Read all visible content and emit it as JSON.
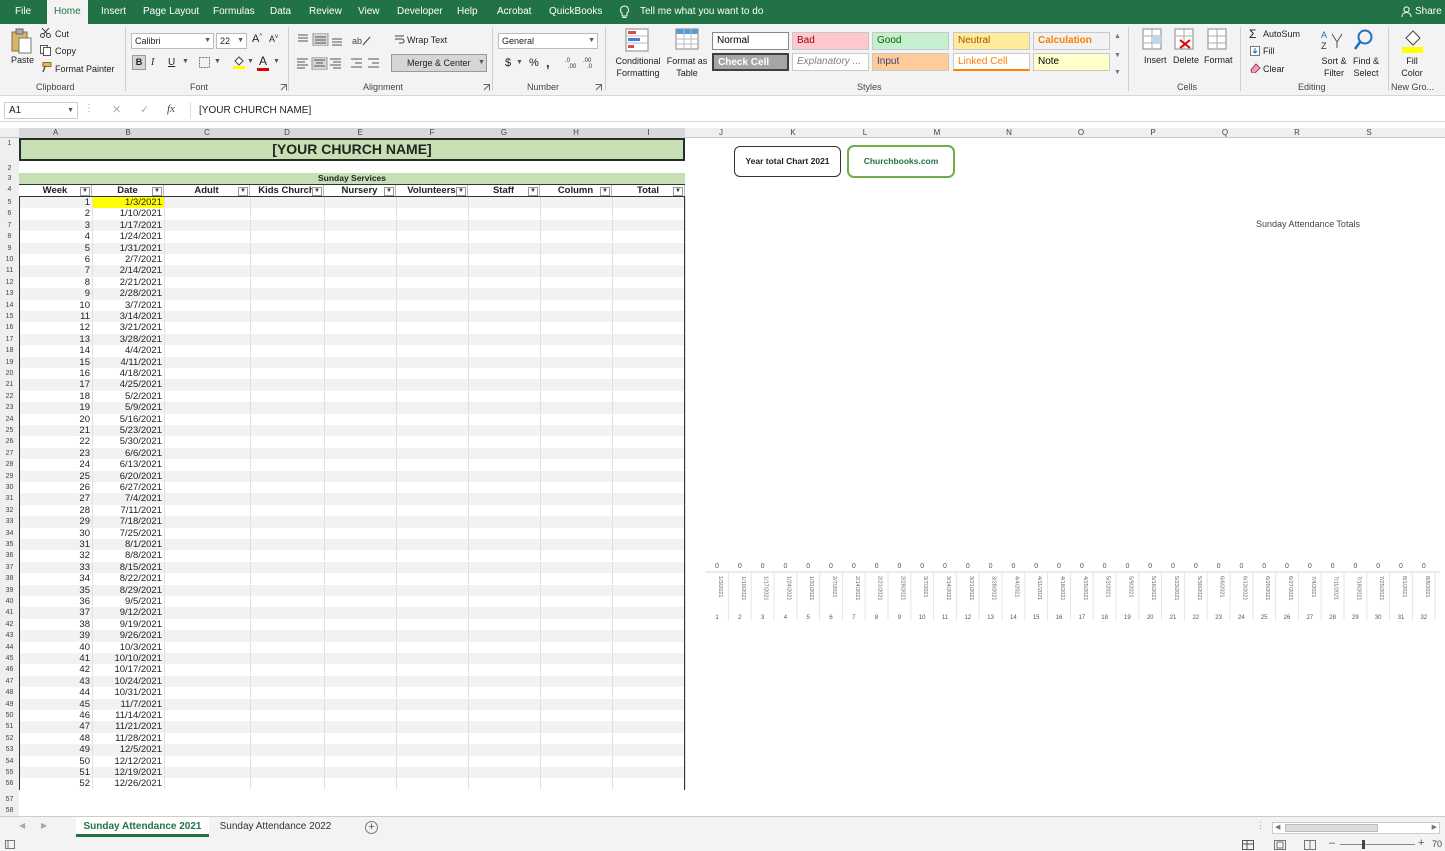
{
  "menu": {
    "tabs": [
      "File",
      "Home",
      "Insert",
      "Page Layout",
      "Formulas",
      "Data",
      "Review",
      "View",
      "Developer",
      "Help",
      "Acrobat",
      "QuickBooks"
    ],
    "tell_me": "Tell me what you want to do",
    "share": "Share"
  },
  "ribbon": {
    "clipboard": {
      "paste": "Paste",
      "cut": "Cut",
      "copy": "Copy",
      "format_painter": "Format Painter",
      "label": "Clipboard"
    },
    "font": {
      "name": "Calibri",
      "size": "22",
      "bold": "B",
      "italic": "I",
      "underline": "U",
      "label": "Font"
    },
    "alignment": {
      "wrap_text": "Wrap Text",
      "merge_center": "Merge & Center",
      "label": "Alignment"
    },
    "number": {
      "format": "General",
      "currency": "$",
      "percent": "%",
      "comma": ",",
      "label": "Number"
    },
    "styles": {
      "conditional": "Conditional Formatting",
      "format_table": "Format as Table",
      "cells": [
        {
          "name": "Normal",
          "bg": "#ffffff",
          "fg": "#000000"
        },
        {
          "name": "Bad",
          "bg": "#ffc7ce",
          "fg": "#9c0006"
        },
        {
          "name": "Good",
          "bg": "#c6efce",
          "fg": "#006100"
        },
        {
          "name": "Neutral",
          "bg": "#ffeb9c",
          "fg": "#9c5700"
        },
        {
          "name": "Calculation",
          "bg": "#f2f2f2",
          "fg": "#fa7d00"
        },
        {
          "name": "Check Cell",
          "bg": "#a5a5a5",
          "fg": "#ffffff"
        },
        {
          "name": "Explanatory ...",
          "bg": "#ffffff",
          "fg": "#7f7f7f"
        },
        {
          "name": "Input",
          "bg": "#ffcc99",
          "fg": "#3f3f76"
        },
        {
          "name": "Linked Cell",
          "bg": "#ffffff",
          "fg": "#fa7d00"
        },
        {
          "name": "Note",
          "bg": "#ffffcc",
          "fg": "#000000"
        }
      ],
      "label": "Styles"
    },
    "cells": {
      "insert": "Insert",
      "delete": "Delete",
      "format": "Format",
      "label": "Cells"
    },
    "editing": {
      "autosum": "AutoSum",
      "fill": "Fill",
      "clear": "Clear",
      "sort_filter": "Sort & Filter",
      "find_select": "Find & Select",
      "label": "Editing"
    },
    "new_group": {
      "fill_color": "Fill Color",
      "label": "New Gro..."
    }
  },
  "formula_bar": {
    "name_box": "A1",
    "fx": "fx",
    "value": "[YOUR CHURCH NAME]"
  },
  "columns": [
    "A",
    "B",
    "C",
    "D",
    "E",
    "F",
    "G",
    "H",
    "I",
    "J",
    "K",
    "L",
    "M",
    "N",
    "O",
    "P",
    "Q",
    "R",
    "S"
  ],
  "sheet": {
    "title": "[YOUR CHURCH NAME]",
    "subtitle": "Sunday Services",
    "headers": [
      "Week",
      "Date",
      "Adult",
      "Kids Church",
      "Nursery",
      "Volunteers",
      "Staff",
      "Column",
      "Total"
    ],
    "weeks": [
      "1",
      "2",
      "3",
      "4",
      "5",
      "6",
      "7",
      "8",
      "9",
      "10",
      "11",
      "12",
      "13",
      "14",
      "15",
      "16",
      "17",
      "18",
      "19",
      "20",
      "21",
      "22",
      "23",
      "24",
      "25",
      "26",
      "27",
      "28",
      "29",
      "30",
      "31",
      "32",
      "33",
      "34",
      "35",
      "36",
      "37",
      "38",
      "39",
      "40",
      "41",
      "42",
      "43",
      "44",
      "45",
      "46",
      "47",
      "48",
      "49",
      "50",
      "51",
      "52"
    ],
    "dates": [
      "1/3/2021",
      "1/10/2021",
      "1/17/2021",
      "1/24/2021",
      "1/31/2021",
      "2/7/2021",
      "2/14/2021",
      "2/21/2021",
      "2/28/2021",
      "3/7/2021",
      "3/14/2021",
      "3/21/2021",
      "3/28/2021",
      "4/4/2021",
      "4/11/2021",
      "4/18/2021",
      "4/25/2021",
      "5/2/2021",
      "5/9/2021",
      "5/16/2021",
      "5/23/2021",
      "5/30/2021",
      "6/6/2021",
      "6/13/2021",
      "6/20/2021",
      "6/27/2021",
      "7/4/2021",
      "7/11/2021",
      "7/18/2021",
      "7/25/2021",
      "8/1/2021",
      "8/8/2021",
      "8/15/2021",
      "8/22/2021",
      "8/29/2021",
      "9/5/2021",
      "9/12/2021",
      "9/19/2021",
      "9/26/2021",
      "10/3/2021",
      "10/10/2021",
      "10/17/2021",
      "10/24/2021",
      "10/31/2021",
      "11/7/2021",
      "11/14/2021",
      "11/21/2021",
      "11/28/2021",
      "12/5/2021",
      "12/12/2021",
      "12/19/2021",
      "12/26/2021"
    ]
  },
  "buttons": {
    "year_chart": "Year total Chart 2021",
    "churchbooks": "Churchbooks.com"
  },
  "chart_data": {
    "type": "bar",
    "title": "Sunday Attendance Totals",
    "categories": [
      "1/3/2021",
      "1/10/2021",
      "1/17/2021",
      "1/24/2021",
      "1/31/2021",
      "2/7/2021",
      "2/14/2021",
      "2/21/2021",
      "2/28/2021",
      "3/7/2021",
      "3/14/2021",
      "3/21/2021",
      "3/28/2021",
      "4/4/2021",
      "4/11/2021",
      "4/18/2021",
      "4/25/2021",
      "5/2/2021",
      "5/9/2021",
      "5/16/2021",
      "5/23/2021",
      "5/30/2021",
      "6/6/2021",
      "6/13/2021",
      "6/20/2021",
      "6/27/2021",
      "7/4/2021",
      "7/11/2021",
      "7/18/2021",
      "7/25/2021",
      "8/1/2021",
      "8/8/2021"
    ],
    "week_labels": [
      "1",
      "2",
      "3",
      "4",
      "5",
      "6",
      "7",
      "8",
      "9",
      "10",
      "11",
      "12",
      "13",
      "14",
      "15",
      "16",
      "17",
      "18",
      "19",
      "20",
      "21",
      "22",
      "23",
      "24",
      "25",
      "26",
      "27",
      "28",
      "29",
      "30",
      "31",
      "32"
    ],
    "values": [
      0,
      0,
      0,
      0,
      0,
      0,
      0,
      0,
      0,
      0,
      0,
      0,
      0,
      0,
      0,
      0,
      0,
      0,
      0,
      0,
      0,
      0,
      0,
      0,
      0,
      0,
      0,
      0,
      0,
      0,
      0,
      0
    ]
  },
  "sheet_tabs": [
    "Sunday Attendance 2021",
    "Sunday Attendance 2022"
  ],
  "status": {
    "zoom": "70"
  }
}
